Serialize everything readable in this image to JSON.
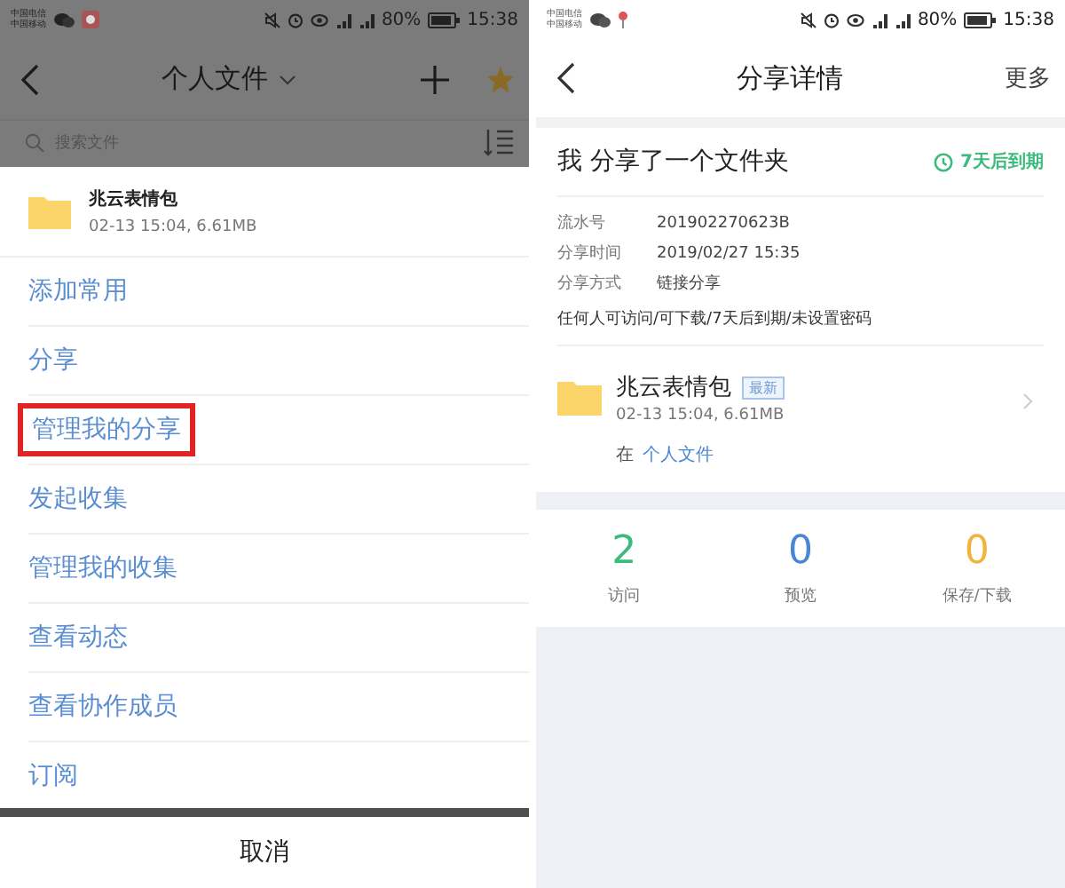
{
  "left": {
    "status_bar": {
      "carriers": [
        "中国电信",
        "中国移动"
      ],
      "battery": "80%",
      "time": "15:38"
    },
    "header": {
      "title": "个人文件"
    },
    "search": {
      "placeholder": "搜索文件"
    },
    "file": {
      "name": "兆云表情包",
      "meta": "02-13 15:04, 6.61MB"
    },
    "menu": [
      {
        "label": "添加常用",
        "highlighted": false
      },
      {
        "label": "分享",
        "highlighted": false
      },
      {
        "label": "管理我的分享",
        "highlighted": true
      },
      {
        "label": "发起收集",
        "highlighted": false
      },
      {
        "label": "管理我的收集",
        "highlighted": false
      },
      {
        "label": "查看动态",
        "highlighted": false
      },
      {
        "label": "查看协作成员",
        "highlighted": false
      },
      {
        "label": "订阅",
        "highlighted": false
      }
    ],
    "cancel": "取消"
  },
  "right": {
    "status_bar": {
      "carriers": [
        "中国电信",
        "中国移动"
      ],
      "battery": "80%",
      "time": "15:38"
    },
    "header": {
      "title": "分享详情",
      "more": "更多"
    },
    "share": {
      "title": "我 分享了一个文件夹",
      "expiry": "7天后到期",
      "details": [
        {
          "label": "流水号",
          "value": "201902270623B"
        },
        {
          "label": "分享时间",
          "value": "2019/02/27 15:35"
        },
        {
          "label": "分享方式",
          "value": "链接分享"
        }
      ],
      "permissions": "任何人可访问/可下载/7天后到期/未设置密码"
    },
    "file": {
      "name": "兆云表情包",
      "badge": "最新",
      "meta": "02-13 15:04, 6.61MB",
      "location_prefix": "在",
      "location": "个人文件"
    },
    "stats": [
      {
        "value": "2",
        "label": "访问",
        "color": "#3dbb7e"
      },
      {
        "value": "0",
        "label": "预览",
        "color": "#4a86d8"
      },
      {
        "value": "0",
        "label": "保存/下载",
        "color": "#f0b43c"
      }
    ]
  }
}
